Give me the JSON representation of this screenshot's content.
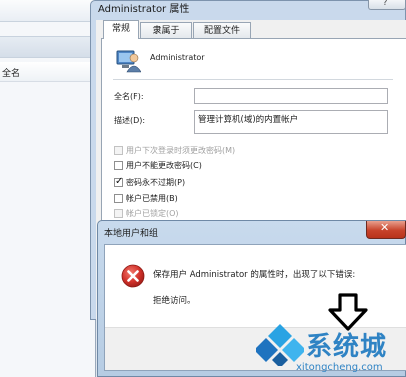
{
  "background_window": {
    "column_header": "全名"
  },
  "properties": {
    "title": "Administrator 属性",
    "tabs": [
      "常规",
      "隶属于",
      "配置文件"
    ],
    "user_name": "Administrator",
    "fullname_label": "全名(F):",
    "fullname_value": "",
    "description_label": "描述(D):",
    "description_value": "管理计算机(域)的内置帐户",
    "checkboxes": [
      {
        "label": "用户下次登录时须更改密码(M)",
        "checked": false,
        "disabled": true
      },
      {
        "label": "用户不能更改密码(C)",
        "checked": false,
        "disabled": false
      },
      {
        "label": "密码永不过期(P)",
        "checked": true,
        "disabled": false
      },
      {
        "label": "帐户已禁用(B)",
        "checked": false,
        "disabled": false
      },
      {
        "label": "帐户已锁定(O)",
        "checked": false,
        "disabled": true
      }
    ]
  },
  "error_dialog": {
    "title": "本地用户和组",
    "message": "保存用户 Administrator 的属性时，出现了以下错误:",
    "detail": "拒绝访问。",
    "icon": "error-icon"
  },
  "watermark": {
    "name": "系统城",
    "domain": "xitongcheng.com"
  },
  "colors": {
    "error_red": "#d1312a",
    "watermark_blue": "#2f83c4",
    "close_button": "#c7432b"
  }
}
